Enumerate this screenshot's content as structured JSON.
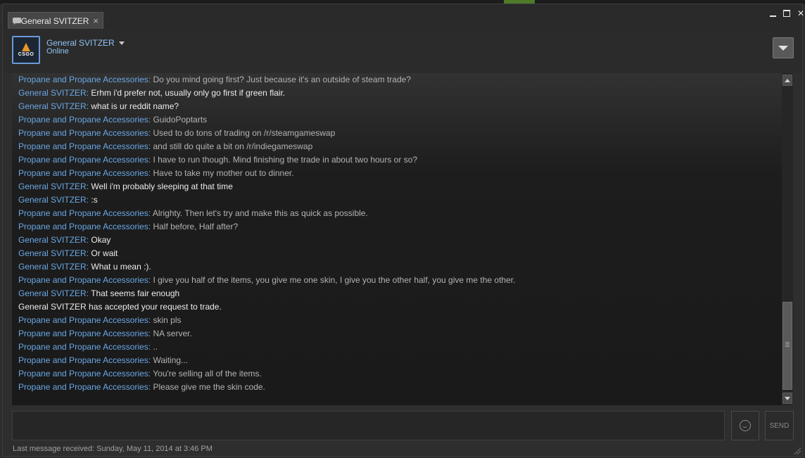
{
  "window": {
    "tab_title": "General SVITZER",
    "tab_close": "×",
    "controls": {
      "minimize": "",
      "maximize": "",
      "close": "✕"
    }
  },
  "header": {
    "friend_name": "General SVITZER",
    "status": "Online",
    "avatar_text": "CSGO"
  },
  "chat": {
    "messages": [
      {
        "sender": "Propane and Propane Accessories",
        "text": "Do you mind going first? Just because it's an outside of steam trade?",
        "self": false
      },
      {
        "sender": "General SVITZER",
        "text": "Erhm i'd prefer not, usually only go first if green flair.",
        "self": true
      },
      {
        "sender": "General SVITZER",
        "text": "what is ur reddit name?",
        "self": true
      },
      {
        "sender": "Propane and Propane Accessories",
        "text": "GuidoPoptarts",
        "self": false
      },
      {
        "sender": "Propane and Propane Accessories",
        "text": "Used to do tons of trading on /r/steamgameswap",
        "self": false
      },
      {
        "sender": "Propane and Propane Accessories",
        "text": "and still do quite a bit on /r/indiegameswap",
        "self": false
      },
      {
        "sender": "Propane and Propane Accessories",
        "text": "I have to run though. Mind finishing the trade in about two hours or so?",
        "self": false
      },
      {
        "sender": "Propane and Propane Accessories",
        "text": "Have to take my mother out to dinner.",
        "self": false
      },
      {
        "sender": "General SVITZER",
        "text": "Well i'm probably sleeping at that time",
        "self": true
      },
      {
        "sender": "General SVITZER",
        "text": ":s",
        "self": true
      },
      {
        "sender": "Propane and Propane Accessories",
        "text": "Alrighty. Then let's try and make this as quick as possible.",
        "self": false
      },
      {
        "sender": "Propane and Propane Accessories",
        "text": "Half before, Half after?",
        "self": false
      },
      {
        "sender": "General SVITZER",
        "text": "Okay",
        "self": true
      },
      {
        "sender": "General SVITZER",
        "text": "Or wait",
        "self": true
      },
      {
        "sender": "General SVITZER",
        "text": "What u mean :).",
        "self": true
      },
      {
        "sender": "Propane and Propane Accessories",
        "text": "I give you half of the items, you give me one skin, I give you the other half, you give me the other.",
        "self": false
      },
      {
        "sender": "General SVITZER",
        "text": "That seems fair enough",
        "self": true
      },
      {
        "system": "General SVITZER has accepted your request to trade."
      },
      {
        "sender": "Propane and Propane Accessories",
        "text": "skin pls",
        "self": false
      },
      {
        "sender": "Propane and Propane Accessories",
        "text": "NA server.",
        "self": false
      },
      {
        "sender": "Propane and Propane Accessories",
        "text": "..",
        "self": false
      },
      {
        "sender": "Propane and Propane Accessories",
        "text": "Waiting...",
        "self": false
      },
      {
        "sender": "Propane and Propane Accessories",
        "text": "You're selling all of the items.",
        "self": false
      },
      {
        "sender": "Propane and Propane Accessories",
        "text": "Please give me the skin code.",
        "self": false
      }
    ]
  },
  "input": {
    "value": "",
    "send_label": "SEND"
  },
  "footer": {
    "last_message": "Last message received: Sunday, May 11, 2014 at 3:46 PM"
  }
}
